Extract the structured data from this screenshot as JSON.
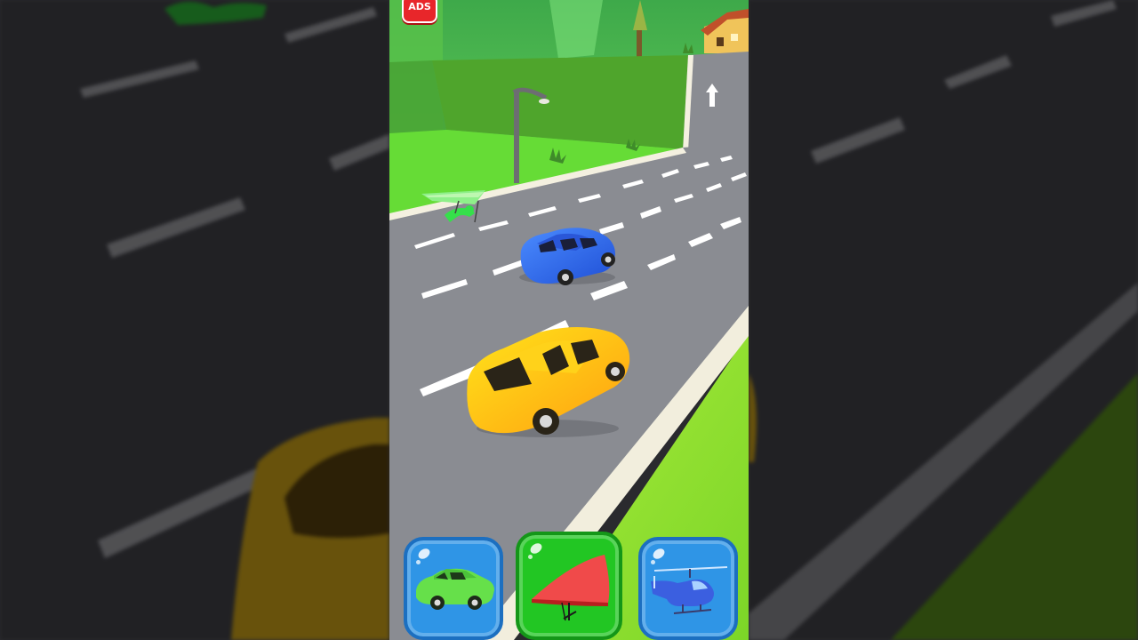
{
  "hud": {
    "ads_label": "ADS",
    "ads_icon": "no-ads-icon"
  },
  "scene": {
    "direction_sign_icon": "up-arrow-icon",
    "player_vehicle": "hang-glider",
    "opponent_vehicles": [
      "blue-car",
      "yellow-car"
    ]
  },
  "vehicle_selector": {
    "options": [
      {
        "id": "car",
        "icon": "green-car-icon",
        "color": "#2f95e6",
        "selected": false
      },
      {
        "id": "glider",
        "icon": "hang-glider-icon",
        "color": "#22c623",
        "selected": true
      },
      {
        "id": "helicopter",
        "icon": "helicopter-icon",
        "color": "#2f95e6",
        "selected": false
      }
    ]
  },
  "colors": {
    "road": "#8a8c92",
    "grass": "#6fd93a",
    "wall": "#4aa02a",
    "player_green": "#35e04a",
    "yellow_car": "#ffcc00",
    "blue_car": "#2f6fe8"
  }
}
